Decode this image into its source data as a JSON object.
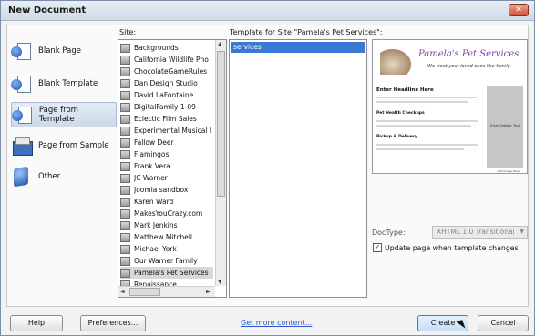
{
  "window": {
    "title": "New Document"
  },
  "categories": [
    {
      "label": "Blank Page",
      "icon": "blank-page-icon"
    },
    {
      "label": "Blank Template",
      "icon": "blank-template-icon"
    },
    {
      "label": "Page from Template",
      "icon": "page-from-template-icon",
      "selected": true
    },
    {
      "label": "Page from Sample",
      "icon": "page-from-sample-icon"
    },
    {
      "label": "Other",
      "icon": "other-icon"
    }
  ],
  "site_column": {
    "label": "Site:"
  },
  "sites": [
    "Backgrounds",
    "California Wildlife Pho",
    "ChocolateGameRules",
    "Dan Design Studio",
    "David LaFontaine",
    "DigitalFamily 1-09",
    "Eclectic Film Sales",
    "Experimental Musical I",
    "Fallow Deer",
    "Flamingos",
    "Frank Vera",
    "JC Warner",
    "Joomla sandbox",
    "Karen Ward",
    "MakesYouCrazy.com",
    "Mark Jenkins",
    "Matthew Mitchell",
    "Michael York",
    "Our Warner Family",
    "Pamela's Pet Services",
    "Renaissance"
  ],
  "selected_site": "Pamela's Pet Services",
  "template_column": {
    "label": "Template for Site \"Pamela's Pet Services\":"
  },
  "templates": [
    "services"
  ],
  "preview": {
    "brand": "Pamela's Pet Services",
    "tagline": "We treat your loved ones like family",
    "heading": "Enter Headline Here",
    "sub1": "Pet Health Checkups",
    "sub2": "Pickup & Delivery",
    "sidebar_text": "Enter Sidebar Text",
    "photo_label": "Add Image Here"
  },
  "doctype": {
    "label": "DocType:",
    "value": "XHTML 1.0 Transitional"
  },
  "update_checkbox": {
    "label": "Update page when template changes",
    "checked": true
  },
  "footer": {
    "help": "Help",
    "preferences": "Preferences...",
    "get_more": "Get more content...",
    "create": "Create",
    "cancel": "Cancel"
  }
}
